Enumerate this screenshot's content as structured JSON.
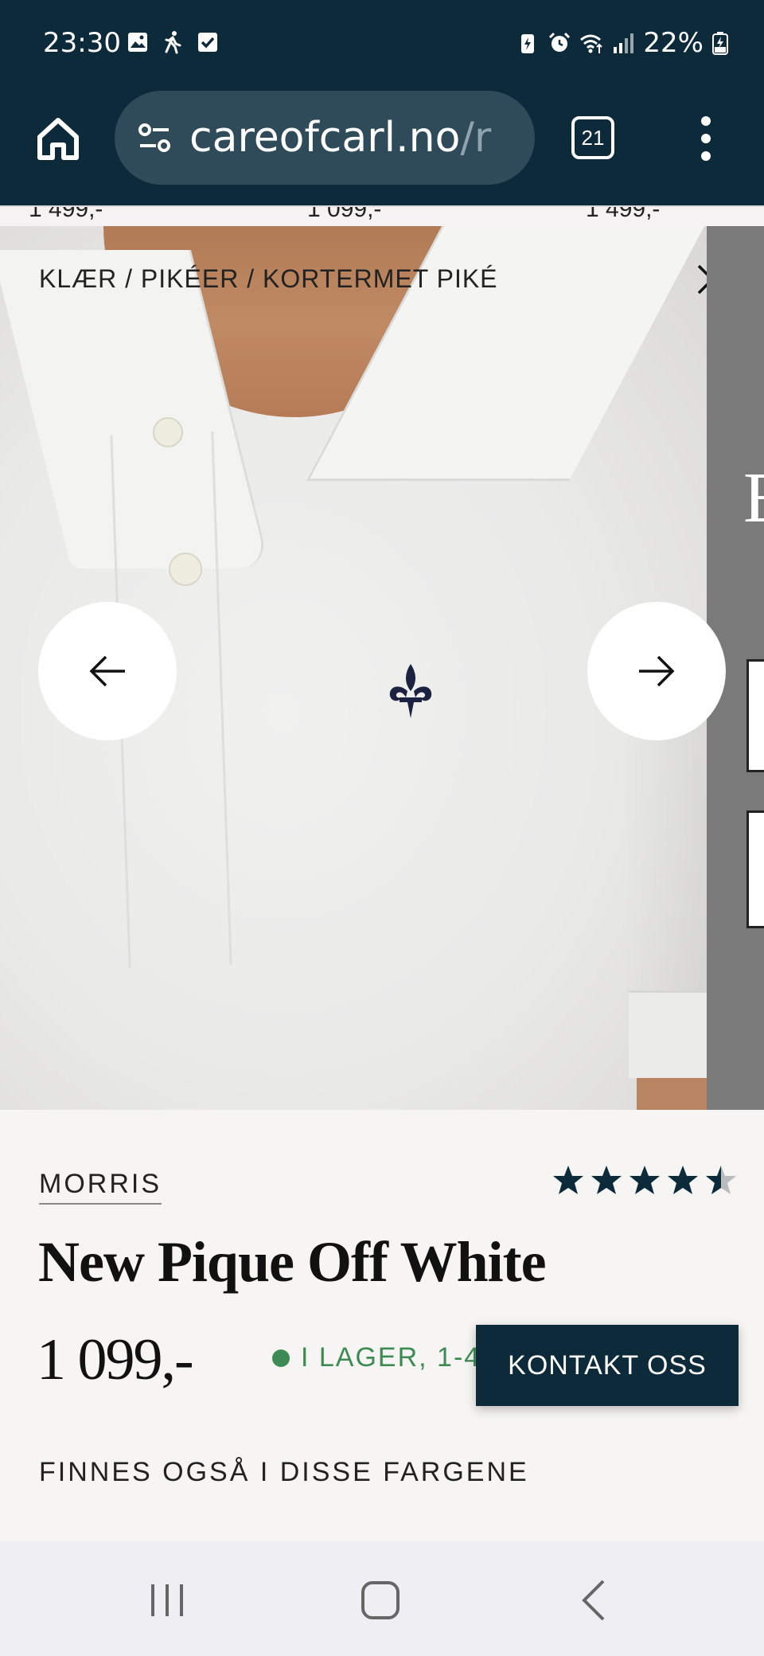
{
  "status": {
    "time": "23:30",
    "battery": "22%"
  },
  "browser": {
    "url_main": "careofcarl.no",
    "url_rest": "/r",
    "tab_count": "21"
  },
  "behind": {
    "prices": [
      "1 499,-",
      "1 099,-",
      "1 499,-"
    ]
  },
  "breadcrumb": "KLÆR / PIKÉER / KORTERMET PIKÉ",
  "side_panel": {
    "letter": "E"
  },
  "product": {
    "brand": "MORRIS",
    "rating": 4.5,
    "name": "New Pique Off White",
    "price": "1 099,-",
    "stock": "I LAGER, 1-4",
    "contact_label": "KONTAKT OSS",
    "colors_heading": "FINNES OGSÅ I DISSE FARGENE"
  },
  "colors": {
    "status_bar": "#0d2a3b",
    "stock_green": "#3e8a55",
    "star": "#0d2a3b"
  }
}
